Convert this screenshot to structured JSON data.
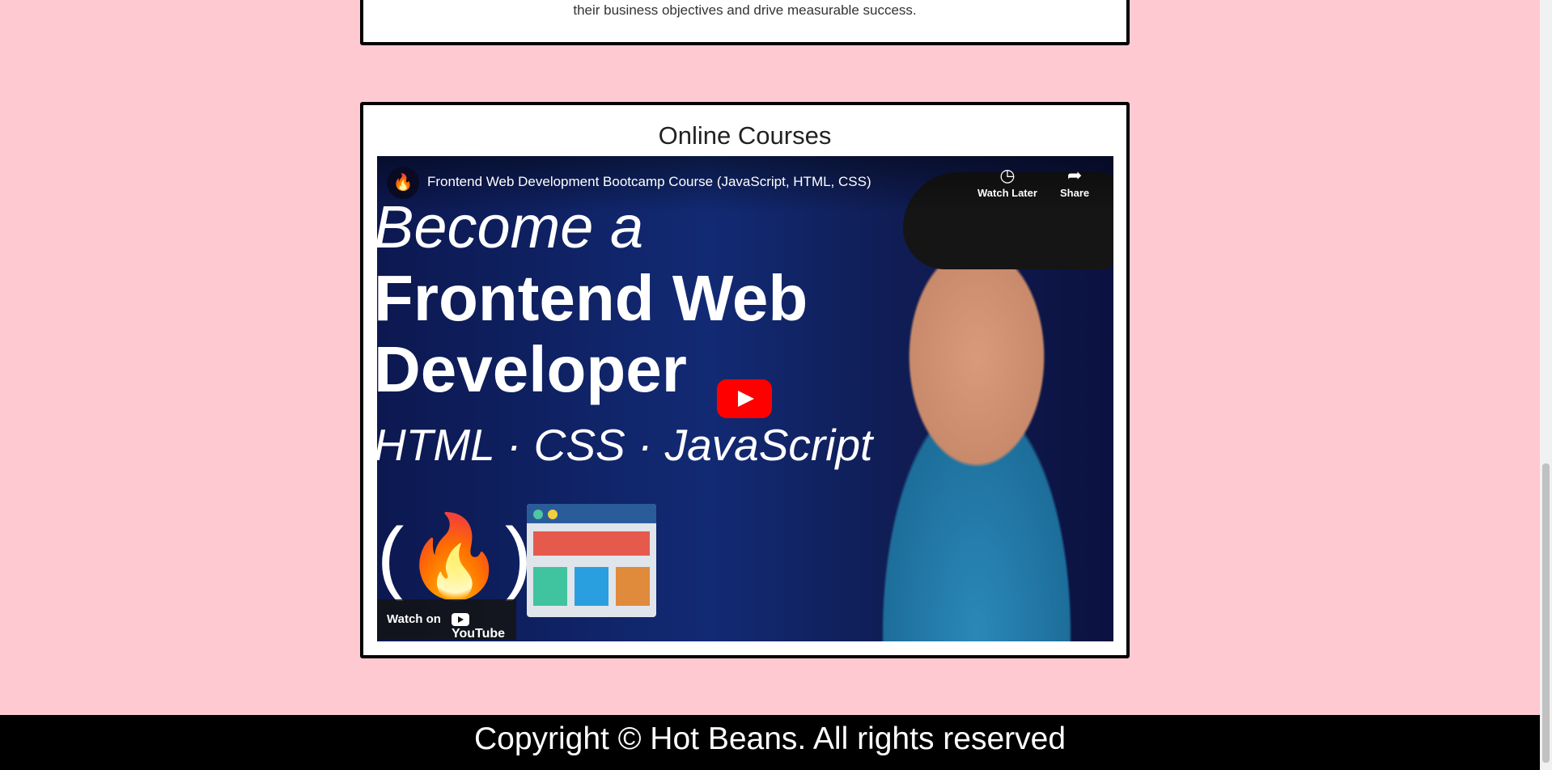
{
  "top_card": {
    "text": "their business objectives and drive measurable success."
  },
  "courses": {
    "heading": "Online Courses",
    "video": {
      "title": "Frontend Web Development Bootcamp Course (JavaScript, HTML, CSS)",
      "channel_icon": "freecodecamp-logo-icon",
      "watch_later_label": "Watch Later",
      "share_label": "Share",
      "watch_on_label": "Watch on",
      "youtube_label": "YouTube",
      "thumbnail": {
        "line1": "Become a",
        "line2": "Frontend Web",
        "line3": "Developer",
        "line4": "HTML · CSS · JavaScript"
      }
    }
  },
  "footer": {
    "copyright": "Copyright © Hot Beans. All rights reserved"
  },
  "colors": {
    "page_bg": "#ffc9d2",
    "card_border": "#000000",
    "footer_bg": "#000000",
    "play_button": "#ff0000"
  }
}
